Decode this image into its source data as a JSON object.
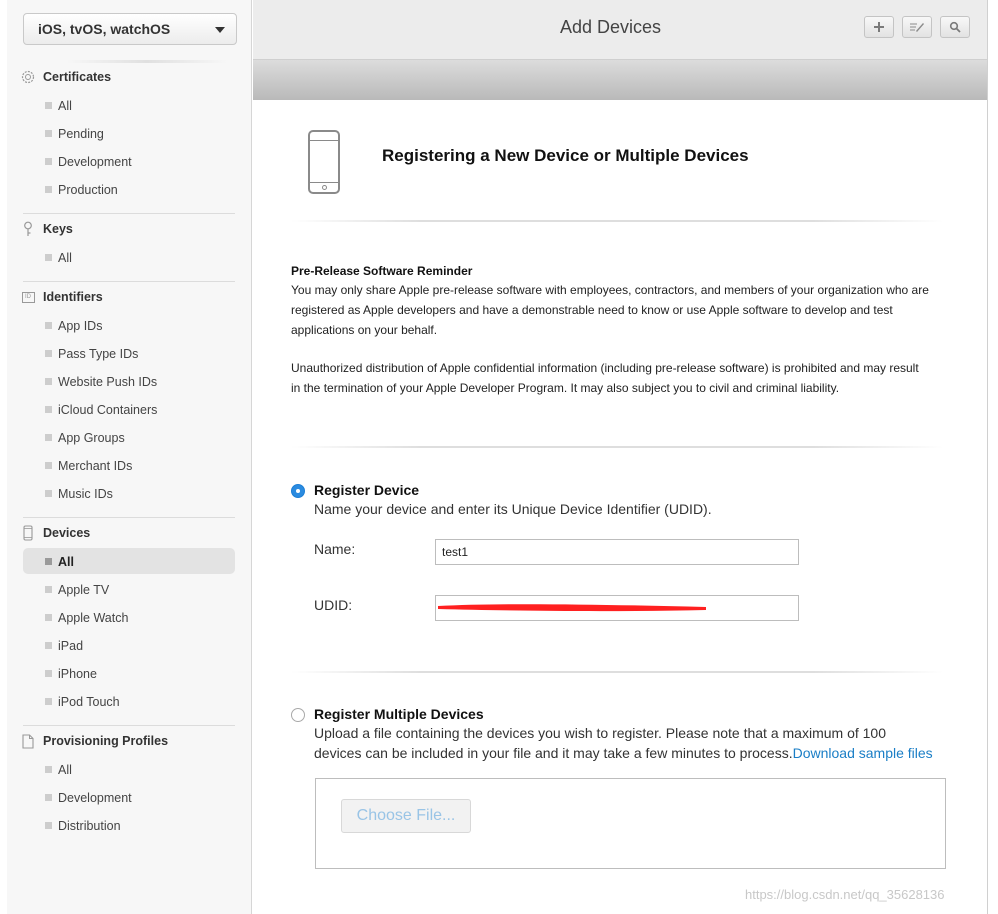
{
  "sidebar": {
    "platform": "iOS, tvOS, watchOS",
    "sections": {
      "certificates": {
        "title": "Certificates",
        "icon": "certificate-icon",
        "items": [
          "All",
          "Pending",
          "Development",
          "Production"
        ]
      },
      "keys": {
        "title": "Keys",
        "icon": "key-icon",
        "items": [
          "All"
        ]
      },
      "identifiers": {
        "title": "Identifiers",
        "icon": "id-icon",
        "icon_text": "ID",
        "items": [
          "App IDs",
          "Pass Type IDs",
          "Website Push IDs",
          "iCloud Containers",
          "App Groups",
          "Merchant IDs",
          "Music IDs"
        ]
      },
      "devices": {
        "title": "Devices",
        "icon": "device-icon",
        "items": [
          "All",
          "Apple TV",
          "Apple Watch",
          "iPad",
          "iPhone",
          "iPod Touch"
        ],
        "selected": "All"
      },
      "profiles": {
        "title": "Provisioning Profiles",
        "icon": "document-icon",
        "items": [
          "All",
          "Development",
          "Distribution"
        ]
      }
    }
  },
  "header": {
    "title": "Add Devices",
    "buttons": [
      "plus-icon",
      "edit-icon",
      "search-icon"
    ]
  },
  "main": {
    "heading": "Registering a New Device or Multiple Devices",
    "heading_icon": "iphone-icon",
    "reminder_title": "Pre-Release Software Reminder",
    "reminder_lines": [
      "You may only share Apple pre-release software with employees, contractors, and members of your organization who are",
      "registered as Apple developers and have a demonstrable need to know or use Apple software to develop and test",
      "applications on your behalf."
    ],
    "warning_lines": [
      "Unauthorized distribution of Apple confidential information (including pre-release software) is prohibited and may result",
      "in the termination of your Apple Developer Program. It may also subject you to civil and criminal liability."
    ],
    "register_device": {
      "title": "Register Device",
      "description": "Name your device and enter its Unique Device Identifier (UDID).",
      "selected": true,
      "name_label": "Name:",
      "name_value": "test1",
      "udid_label": "UDID:",
      "udid_value": "",
      "redaction_color": "#ff2020"
    },
    "register_multiple": {
      "title": "Register Multiple Devices",
      "description_line1": "Upload a file containing the devices you wish to register. Please note that a maximum of 100",
      "description_line2": "devices can be included in your file and it may take a few minutes to process.",
      "link": "Download sample files",
      "selected": false,
      "choose_file": "Choose File..."
    }
  },
  "watermark": "https://blog.csdn.net/qq_35628136",
  "colors": {
    "accent": "#2b8be0",
    "link": "#1a7ec6",
    "header_bg": "#ececec",
    "sidebar_bg": "#f7f7f7"
  }
}
